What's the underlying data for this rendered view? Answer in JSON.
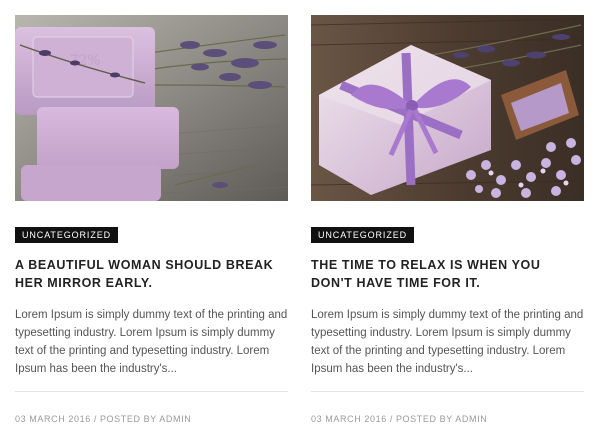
{
  "posts": [
    {
      "image_icon": "lavender-soap-stack-image",
      "category": "UNCATEGORIZED",
      "title": "A BEAUTIFUL WOMAN SHOULD BREAK HER MIRROR EARLY.",
      "excerpt": "Lorem Ipsum is simply dummy text of the printing and typesetting industry. Lorem Ipsum is simply dummy text of the printing and typesetting industry. Lorem Ipsum has been the industry's...",
      "date": "03 MARCH 2016",
      "separator": "/",
      "posted_by": "POSTED BY ADMIN"
    },
    {
      "image_icon": "lavender-soap-ribbon-image",
      "category": "UNCATEGORIZED",
      "title": "THE TIME TO RELAX IS WHEN YOU DON'T HAVE TIME FOR IT.",
      "excerpt": "Lorem Ipsum is simply dummy text of the printing and typesetting industry. Lorem Ipsum is simply dummy text of the printing and typesetting industry. Lorem Ipsum has been the industry's...",
      "date": "03 MARCH 2016",
      "separator": "/",
      "posted_by": "POSTED BY ADMIN"
    }
  ],
  "colors": {
    "badge_bg": "#111111",
    "title": "#222222",
    "body_text": "#555555",
    "meta_text": "#9a9a9a",
    "divider": "#e3e3e3",
    "soap_lavender": "#c9a9d6"
  }
}
